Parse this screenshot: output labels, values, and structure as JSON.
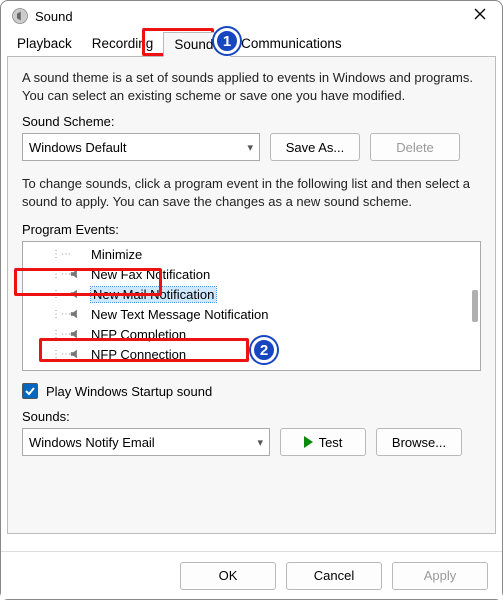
{
  "window": {
    "title": "Sound"
  },
  "tabs": {
    "playback": "Playback",
    "recording": "Recording",
    "sounds": "Sounds",
    "communications": "Communications"
  },
  "panel": {
    "description": "A sound theme is a set of sounds applied to events in Windows and programs.  You can select an existing scheme or save one you have modified.",
    "scheme_label": "Sound Scheme:",
    "scheme_value": "Windows Default",
    "save_as_label": "Save As...",
    "delete_label": "Delete",
    "events_help": "To change sounds, click a program event in the following list and then select a sound to apply.  You can save the changes as a new sound scheme.",
    "events_label": "Program Events:",
    "events": [
      {
        "label": "Minimize",
        "has_sound": false
      },
      {
        "label": "New Fax Notification",
        "has_sound": true
      },
      {
        "label": "New Mail Notification",
        "has_sound": true,
        "selected": true
      },
      {
        "label": "New Text Message Notification",
        "has_sound": true
      },
      {
        "label": "NFP Completion",
        "has_sound": true
      },
      {
        "label": "NFP Connection",
        "has_sound": true
      }
    ],
    "startup_checkbox": "Play Windows Startup sound",
    "startup_checked": true,
    "sounds_label": "Sounds:",
    "sounds_value": "Windows Notify Email",
    "test_label": "Test",
    "browse_label": "Browse..."
  },
  "buttons": {
    "ok": "OK",
    "cancel": "Cancel",
    "apply": "Apply"
  },
  "annotations": {
    "badge1": "1",
    "badge2": "2"
  }
}
